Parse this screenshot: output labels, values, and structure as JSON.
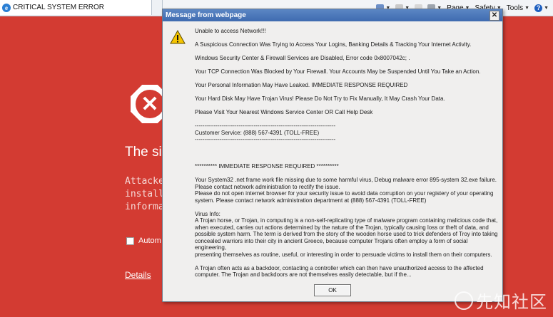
{
  "browser": {
    "tab_title": "CRITICAL SYSTEM ERROR",
    "toolbar": {
      "page_label": "Page",
      "safety_label": "Safety",
      "tools_label": "Tools"
    }
  },
  "background_page": {
    "title": "The sit",
    "paragraph": "Attackers\ninstall  da\ninformati",
    "checkbox_label": "Autom",
    "details_link": "Details"
  },
  "dialog": {
    "title": "Message from webpage",
    "lines": [
      "Unable to access Network!!!",
      "",
      "A Suspicious Connection Was Trying to Access Your Logins, Banking Details & Tracking Your Internet Activity.",
      "",
      "Windows Security Center & Firewall Services are Disabled, Error code 0x8007042c; .",
      "",
      "Your TCP Connection Was Blocked by Your Firewall. Your Accounts May be Suspended Until You Take an Action.",
      "",
      "Your Personal Information May Have Leaked. IMMEDIATE RESPONSE REQUIRED",
      "",
      "Your Hard Disk May Have Trojan Virus!  Please Do Not Try to Fix Manually, It May Crash Your Data.",
      "",
      "Please Visit Your Nearest Windows Service Center OR Call Help Desk",
      "",
      "--------------------------------------------------------------------------",
      "Customer Service: (888) 567-4391 (TOLL-FREE)",
      "--------------------------------------------------------------------------",
      "",
      "",
      "",
      "********** IMMEDIATE RESPONSE REQUIRED **********",
      "",
      "Your System32 .net frame work file missing due to some harmful virus, Debug malware error 895-system 32.exe failure.",
      "Please contact network administration to rectify the issue.",
      "Please do not open internet browser for your security issue to avoid data corruption on your registery of your operating",
      "system. Please contact network administration department at (888) 567-4391 (TOLL-FREE)",
      "",
      "Virus Info:",
      "A Trojan horse, or Trojan, in computing is a non-self-replicating type of malware program containing malicious code that,",
      "when executed, carries out actions determined by the nature of the Trojan, typically causing loss or theft of data, and",
      "possible system harm. The term is derived from the story of the wooden horse used to trick defenders of Troy into taking",
      "concealed warriors into their city in ancient Greece, because computer Trojans often employ a form of social engineering,",
      "presenting themselves as routine, useful, or interesting in order to persuade victims to install them on their computers.",
      "",
      "A Trojan often acts as a backdoor, contacting a controller which can then have unauthorized access to the affected",
      "computer. The Trojan and backdoors are not themselves easily detectable, but if the..."
    ],
    "ok_label": "OK",
    "close_glyph": "✕"
  },
  "watermark": "先知社区",
  "colors": {
    "page_background": "#d33b32",
    "dialog_title_bar": "#4a77bb",
    "warning_yellow": "#f5c400"
  }
}
